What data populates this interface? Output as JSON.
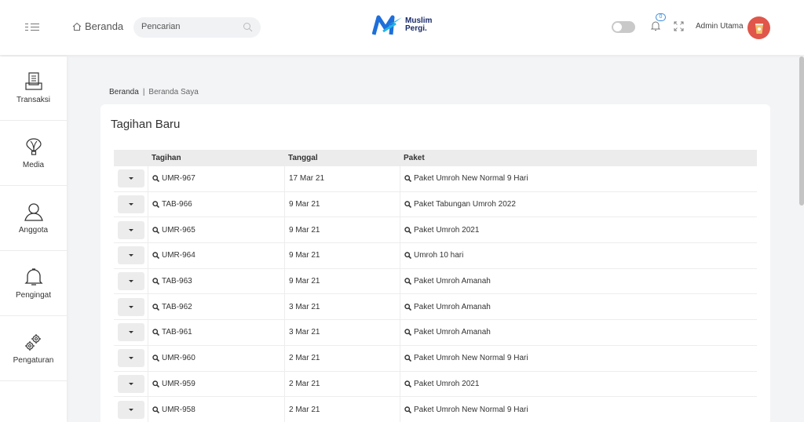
{
  "header": {
    "home_label": "Beranda",
    "search_placeholder": "Pencarian",
    "logo_line1": "Muslim",
    "logo_line2": "Pergi.",
    "notification_count": "0",
    "admin_name": "Admin Utama",
    "colors": {
      "logo_blue": "#1e6fd9",
      "logo_cyan": "#22b5e6",
      "avatar_bg": "#e0564a",
      "badge": "#3a8dde"
    }
  },
  "sidebar": {
    "items": [
      {
        "label": "Transaksi",
        "icon": "receipt-icon"
      },
      {
        "label": "Media",
        "icon": "balloon-icon"
      },
      {
        "label": "Anggota",
        "icon": "user-icon"
      },
      {
        "label": "Pengingat",
        "icon": "bell-icon"
      },
      {
        "label": "Pengaturan",
        "icon": "gears-icon"
      }
    ]
  },
  "breadcrumb": {
    "home": "Beranda",
    "separator": "|",
    "current": "Beranda Saya"
  },
  "card": {
    "title": "Tagihan Baru",
    "columns": [
      "Tagihan",
      "Tanggal",
      "Paket"
    ],
    "rows": [
      {
        "tagihan": "UMR-967",
        "tanggal": "17 Mar 21",
        "paket": "Paket Umroh New Normal 9 Hari"
      },
      {
        "tagihan": "TAB-966",
        "tanggal": "9 Mar 21",
        "paket": "Paket Tabungan Umroh 2022"
      },
      {
        "tagihan": "UMR-965",
        "tanggal": "9 Mar 21",
        "paket": "Paket Umroh 2021"
      },
      {
        "tagihan": "UMR-964",
        "tanggal": "9 Mar 21",
        "paket": "Umroh 10 hari"
      },
      {
        "tagihan": "TAB-963",
        "tanggal": "9 Mar 21",
        "paket": "Paket Umroh Amanah"
      },
      {
        "tagihan": "TAB-962",
        "tanggal": "3 Mar 21",
        "paket": "Paket Umroh Amanah"
      },
      {
        "tagihan": "TAB-961",
        "tanggal": "3 Mar 21",
        "paket": "Paket Umroh Amanah"
      },
      {
        "tagihan": "UMR-960",
        "tanggal": "2 Mar 21",
        "paket": "Paket Umroh New Normal 9 Hari"
      },
      {
        "tagihan": "UMR-959",
        "tanggal": "2 Mar 21",
        "paket": "Paket Umroh 2021"
      },
      {
        "tagihan": "UMR-958",
        "tanggal": "2 Mar 21",
        "paket": "Paket Umroh New Normal 9 Hari"
      }
    ]
  }
}
